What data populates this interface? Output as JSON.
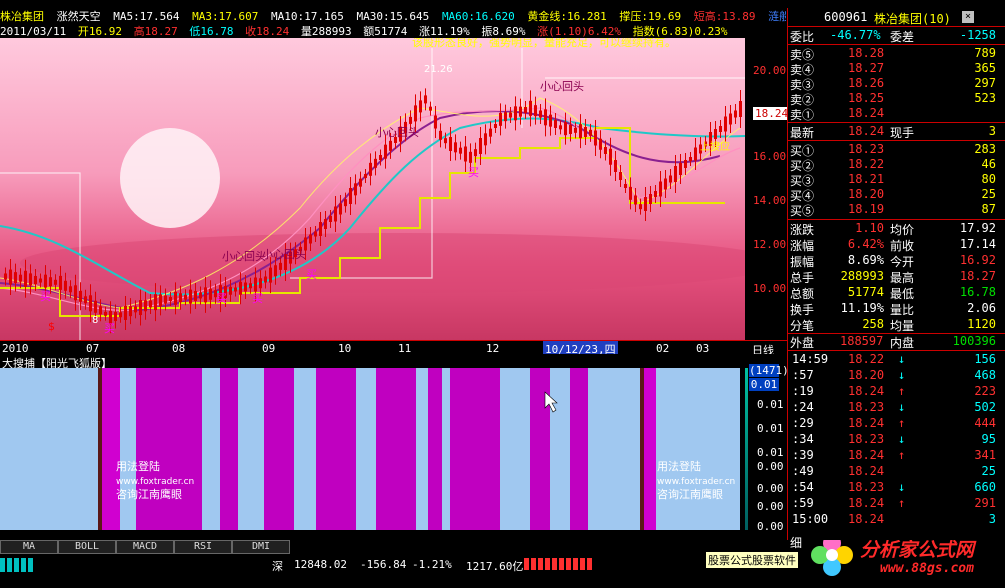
{
  "header": {
    "stock_name": "株冶集团",
    "period_label": "涨然天空",
    "ma5": "MA5:17.564",
    "ma3": "MA3:17.607",
    "ma10": "MA10:17.165",
    "ma30": "MA30:15.645",
    "ma60": "MA60:16.620",
    "gold": "黄金线:16.281",
    "resist": "撑压:19.69",
    "short": "短高:13.89",
    "lian": "涟般"
  },
  "subheader": {
    "date": "2011/03/11",
    "open": "开16.92",
    "high": "高18.27",
    "low": "低16.78",
    "close": "收18.24",
    "vol": "量288993",
    "amt": "额51774",
    "chg": "涨11.19%",
    "amp": "振8.69%",
    "zhang": "涨(1.10)6.42%",
    "idx": "指数(6.83)0.23%"
  },
  "annotation": "该股形态良好，强势明显，量能充足，可以继续持有。",
  "chart_labels": {
    "peak": "21.26",
    "xiao1": "小心回头",
    "xiao2": "小心回头",
    "xiao3": "小心回头",
    "xiao4": "小心回头",
    "mai1": "买",
    "mai2": "买",
    "mai3": "买",
    "mai4": "买",
    "mai5": "买",
    "mai6": "买",
    "low": "8",
    "shangsuo": "上搜应",
    "dollar": "$",
    "price_tag": "18.24"
  },
  "y_ticks": [
    "20.00",
    "18.00",
    "16.00",
    "14.00",
    "12.00",
    "10.00"
  ],
  "x_ticks": [
    "2010",
    "07",
    "08",
    "09",
    "10",
    "11",
    "12",
    "02",
    "03"
  ],
  "x_cursor": "10/12/23,四",
  "x_day": "日线",
  "indicator": {
    "title": "大搜捕【阳光飞狐版】",
    "val1": "(1471)",
    "val2": "0.01",
    "ticks": [
      "0.01",
      "0.01",
      "0.01",
      "0.00",
      "0.00",
      "0.00",
      "0.00"
    ],
    "promo1": "用法登陆",
    "promo2": "www.foxtrader.cn",
    "promo3": "咨询江南鹰眼",
    "promo4": "用法登陆",
    "promo5": "www.foxtrader.cn",
    "promo6": "咨询江南鹰眼"
  },
  "tabs": [
    "MA",
    "BOLL",
    "MACD",
    "RSI",
    "DMI"
  ],
  "status": {
    "market": "深",
    "index": "12848.02",
    "chg": "-156.84",
    "pct": "-1.21%",
    "amt": "1217.60亿",
    "ad": "股票公式股票软件"
  },
  "watermark": {
    "name": "分析家公式网",
    "url": "www.88gs.com"
  },
  "right": {
    "code": "600961",
    "name": "株冶集团(10)",
    "close_icon": "x-icon",
    "weibi_l": "委比",
    "weibi": "-46.77%",
    "weicha_l": "委差",
    "weicha": "-1258",
    "sells": [
      {
        "l": "卖⑤",
        "p": "18.28",
        "v": "789"
      },
      {
        "l": "卖④",
        "p": "18.27",
        "v": "365"
      },
      {
        "l": "卖③",
        "p": "18.26",
        "v": "297"
      },
      {
        "l": "卖②",
        "p": "18.25",
        "v": "523"
      },
      {
        "l": "卖①",
        "p": "18.24",
        "v": ""
      }
    ],
    "last_l": "最新",
    "last": "18.24",
    "now_l": "现手",
    "now": "3",
    "buys": [
      {
        "l": "买①",
        "p": "18.23",
        "v": "283"
      },
      {
        "l": "买②",
        "p": "18.22",
        "v": "46"
      },
      {
        "l": "买③",
        "p": "18.21",
        "v": "80"
      },
      {
        "l": "买④",
        "p": "18.20",
        "v": "25"
      },
      {
        "l": "买⑤",
        "p": "18.19",
        "v": "87"
      }
    ],
    "stats": [
      {
        "a": "涨跌",
        "b": "1.10",
        "c": "均价",
        "d": "17.92"
      },
      {
        "a": "涨幅",
        "b": "6.42%",
        "c": "前收",
        "d": "17.14"
      },
      {
        "a": "振幅",
        "b": "8.69%",
        "c": "今开",
        "d": "16.92"
      },
      {
        "a": "总手",
        "b": "288993",
        "c": "最高",
        "d": "18.27"
      },
      {
        "a": "总额",
        "b": "51774",
        "c": "最低",
        "d": "16.78"
      },
      {
        "a": "换手",
        "b": "11.19%",
        "c": "量比",
        "d": "2.06"
      },
      {
        "a": "分笔",
        "b": "258",
        "c": "均量",
        "d": "1120"
      }
    ],
    "wai_l": "外盘",
    "wai": "188597",
    "nei_l": "内盘",
    "nei": "100396",
    "ticks": [
      {
        "t": "14:59",
        "p": "18.22",
        "d": "↓",
        "v": "156"
      },
      {
        "t": ":57",
        "p": "18.20",
        "d": "↓",
        "v": "468"
      },
      {
        "t": ":19",
        "p": "18.24",
        "d": "↑",
        "v": "223"
      },
      {
        "t": ":24",
        "p": "18.23",
        "d": "↓",
        "v": "502"
      },
      {
        "t": ":29",
        "p": "18.24",
        "d": "↑",
        "v": "444"
      },
      {
        "t": ":34",
        "p": "18.23",
        "d": "↓",
        "v": "95"
      },
      {
        "t": ":39",
        "p": "18.24",
        "d": "↑",
        "v": "341"
      },
      {
        "t": ":49",
        "p": "18.24",
        "d": "",
        "v": "25"
      },
      {
        "t": ":54",
        "p": "18.23",
        "d": "↓",
        "v": "660"
      },
      {
        "t": ":59",
        "p": "18.24",
        "d": "↑",
        "v": "291"
      },
      {
        "t": "15:00",
        "p": "18.24",
        "d": "",
        "v": "3"
      }
    ],
    "xi": "细"
  }
}
